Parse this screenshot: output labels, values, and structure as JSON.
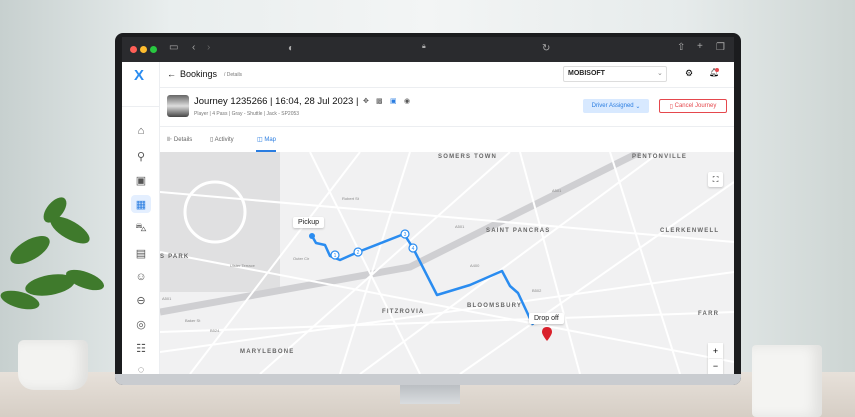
{
  "header": {
    "back_icon": "arrow-left-icon",
    "title": "Bookings",
    "breadcrumb": "/ Details",
    "company": "MOBISOFT",
    "settings_icon": "gear-icon",
    "notification_icon": "bell-icon"
  },
  "journey": {
    "title": "Journey 1235266 | 16:04, 28 Jul 2023 |",
    "subtitle": "Player | 4 Pass  | Gray - Shuttle | Jack - SP2053",
    "status": "Driver Assigned",
    "cancel": "Cancel Journey"
  },
  "tabs": [
    {
      "label": "Details"
    },
    {
      "label": "Activity"
    },
    {
      "label": "Map",
      "active": true
    }
  ],
  "sidebar": [
    "home",
    "bike",
    "document",
    "calendar",
    "car",
    "bus",
    "user",
    "car-side",
    "globe",
    "settings-sliders",
    "help"
  ],
  "map": {
    "pickup": "Pickup",
    "dropoff": "Drop off",
    "stops": [
      "1",
      "2",
      "3",
      "4"
    ],
    "areas": [
      "SOMERS TOWN",
      "PENTONVILLE",
      "SAINT PANCRAS",
      "CLERKENWELL",
      "S PARK",
      "FITZROVIA",
      "BLOOMSBURY",
      "MARYLEBONE",
      "FARR"
    ],
    "roads": [
      "A501",
      "A501",
      "A501",
      "Robert St",
      "Outer Cir",
      "Ulster Terrace",
      "B502",
      "A400",
      "Baker St",
      "B524"
    ],
    "zoom_in": "+",
    "zoom_out": "−",
    "route_color": "#2a8cf0",
    "marker_color": "#d9202b"
  },
  "colors": {
    "accent": "#2a7de1",
    "danger": "#e5484d"
  }
}
